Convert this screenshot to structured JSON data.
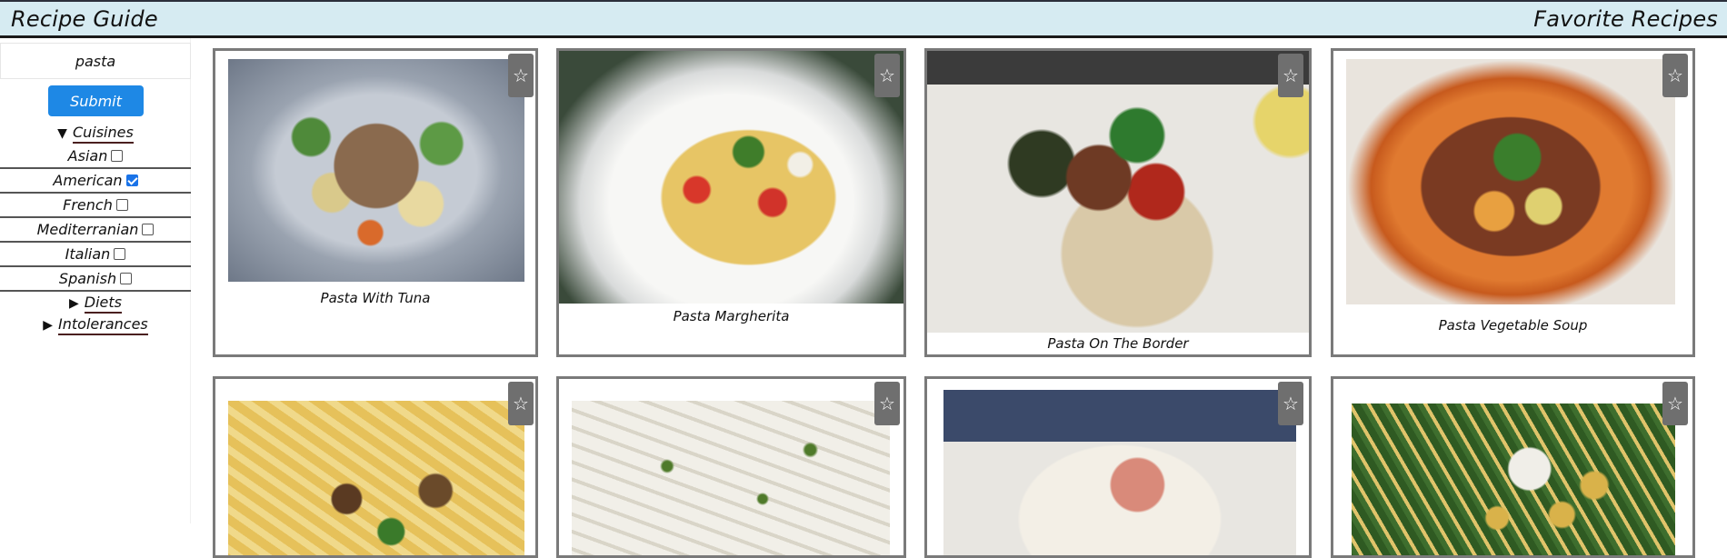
{
  "header": {
    "app_title": "Recipe Guide",
    "favorites_link": "Favorite Recipes"
  },
  "sidebar": {
    "search_value": "pasta",
    "submit_label": "Submit",
    "cuisines_label": "Cuisines",
    "cuisines": [
      {
        "label": "Asian",
        "checked": false
      },
      {
        "label": "American",
        "checked": true
      },
      {
        "label": "French",
        "checked": false
      },
      {
        "label": "Mediterranian",
        "checked": false
      },
      {
        "label": "Italian",
        "checked": false
      },
      {
        "label": "Spanish",
        "checked": false
      }
    ],
    "diets_label": "Diets",
    "intolerances_label": "Intolerances",
    "expanded_arrow": "▼",
    "collapsed_arrow": "▶"
  },
  "recipes": [
    {
      "title": "Pasta With Tuna"
    },
    {
      "title": "Pasta Margherita"
    },
    {
      "title": "Pasta On The Border"
    },
    {
      "title": "Pasta Vegetable Soup"
    },
    {
      "title": ""
    },
    {
      "title": ""
    },
    {
      "title": ""
    },
    {
      "title": ""
    }
  ],
  "star_glyph": "☆",
  "colors": {
    "header_bg": "#d6ebf2",
    "submit_bg": "#1e88e5",
    "card_border": "#7a7a7a",
    "star_bg": "#6f6f6f",
    "checkbox_checked": "#1a73e8"
  }
}
